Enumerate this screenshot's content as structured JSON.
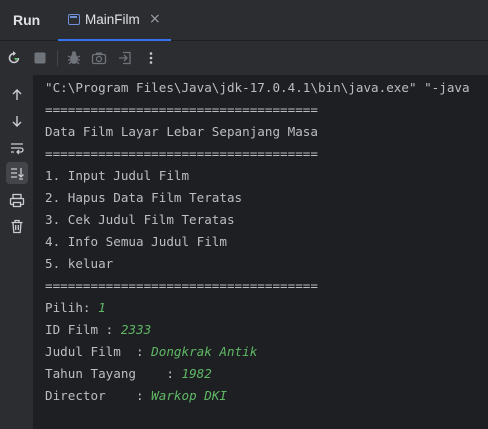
{
  "window": {
    "title": "Run",
    "tab": {
      "label": "MainFilm",
      "close": "×"
    }
  },
  "toolbar": {
    "icons": [
      "rerun-icon",
      "stop-icon",
      "debug-icon",
      "camera-icon",
      "exit-icon",
      "more-icon"
    ]
  },
  "gutter": {
    "icons": [
      "arrow-up-icon",
      "arrow-down-icon",
      "soft-wrap-icon",
      "scroll-to-end-icon",
      "print-icon",
      "trash-icon"
    ]
  },
  "console": {
    "lines": [
      {
        "text": "\"C:\\Program Files\\Java\\jdk-17.0.4.1\\bin\\java.exe\" \"-java"
      },
      {
        "text": "===================================="
      },
      {
        "text": "Data Film Layar Lebar Sepanjang Masa"
      },
      {
        "text": "===================================="
      },
      {
        "text": "1. Input Judul Film"
      },
      {
        "text": "2. Hapus Data Film Teratas"
      },
      {
        "text": "3. Cek Judul Film Teratas"
      },
      {
        "text": "4. Info Semua Judul Film"
      },
      {
        "text": "5. keluar"
      },
      {
        "text": "===================================="
      },
      {
        "text": "Pilih: ",
        "input": "1"
      },
      {
        "text": "ID Film : ",
        "input": "2333"
      },
      {
        "text": "Judul Film  : ",
        "input": "Dongkrak Antik"
      },
      {
        "text": "Tahun Tayang    : ",
        "input": "1982"
      },
      {
        "text": "Director    : ",
        "input": "Warkop DKI"
      }
    ]
  },
  "colors": {
    "background": "#1e1f22",
    "panel": "#2b2d30",
    "accent": "#3574f0",
    "input_text": "#5fb865",
    "console_text": "#bcbec4"
  }
}
